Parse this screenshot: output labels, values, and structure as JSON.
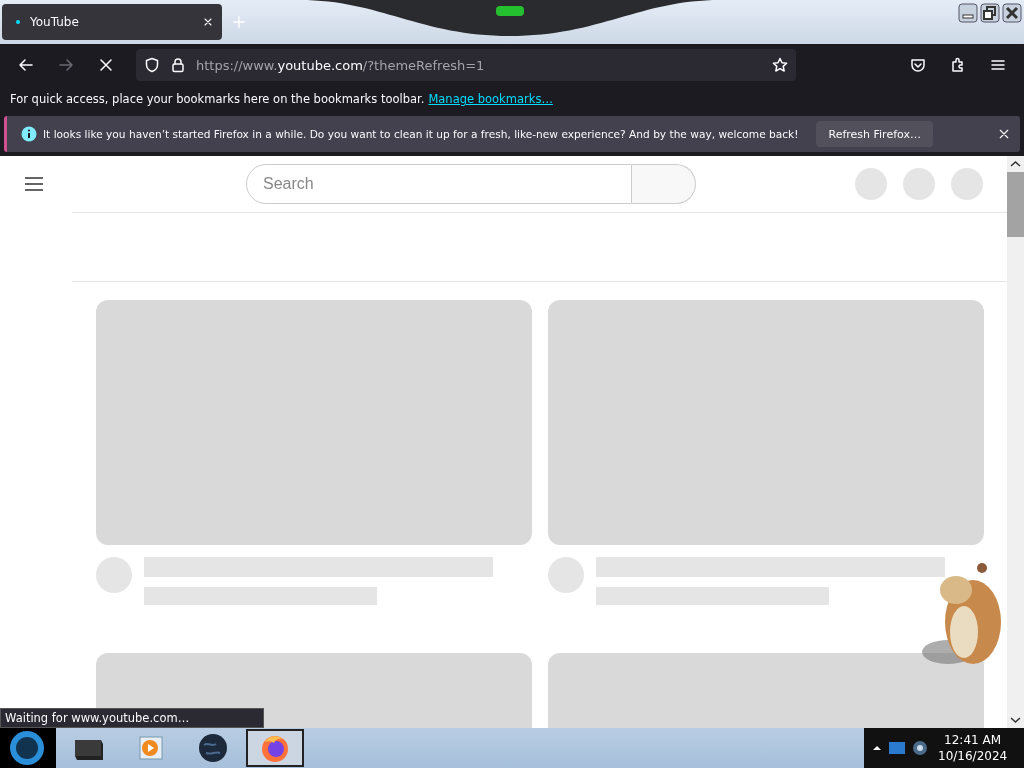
{
  "browser": {
    "tabs": [
      {
        "title": "YouTube",
        "selected": true,
        "loading": true
      }
    ],
    "nav": {
      "back_disabled": false,
      "forward_disabled": true,
      "loading": true
    },
    "url": {
      "prefix": "https://www.",
      "domain": "youtube.com",
      "path": "/?themeRefresh=1"
    },
    "bookmarks_bar": {
      "message": "For quick access, place your bookmarks here on the bookmarks toolbar.",
      "link": "Manage bookmarks…"
    },
    "notification": {
      "message": "It looks like you haven’t started Firefox in a while. Do you want to clean it up for a fresh, like-new experience? And by the way, welcome back!",
      "button": "Refresh Firefox…"
    },
    "status": "Waiting for www.youtube.com…"
  },
  "page": {
    "search": {
      "placeholder": "Search"
    },
    "videos": [
      {
        "kind": "skeleton"
      },
      {
        "kind": "skeleton"
      },
      {
        "kind": "thumbnail"
      },
      {
        "kind": "thumbnail"
      }
    ]
  },
  "taskbar": {
    "apps": [
      {
        "kind": "terminal",
        "selected": false
      },
      {
        "kind": "media",
        "selected": false
      },
      {
        "kind": "globe",
        "selected": false
      },
      {
        "kind": "firefox",
        "selected": true
      }
    ],
    "clock": {
      "time": "12:41 AM",
      "date": "10/16/2024"
    }
  }
}
